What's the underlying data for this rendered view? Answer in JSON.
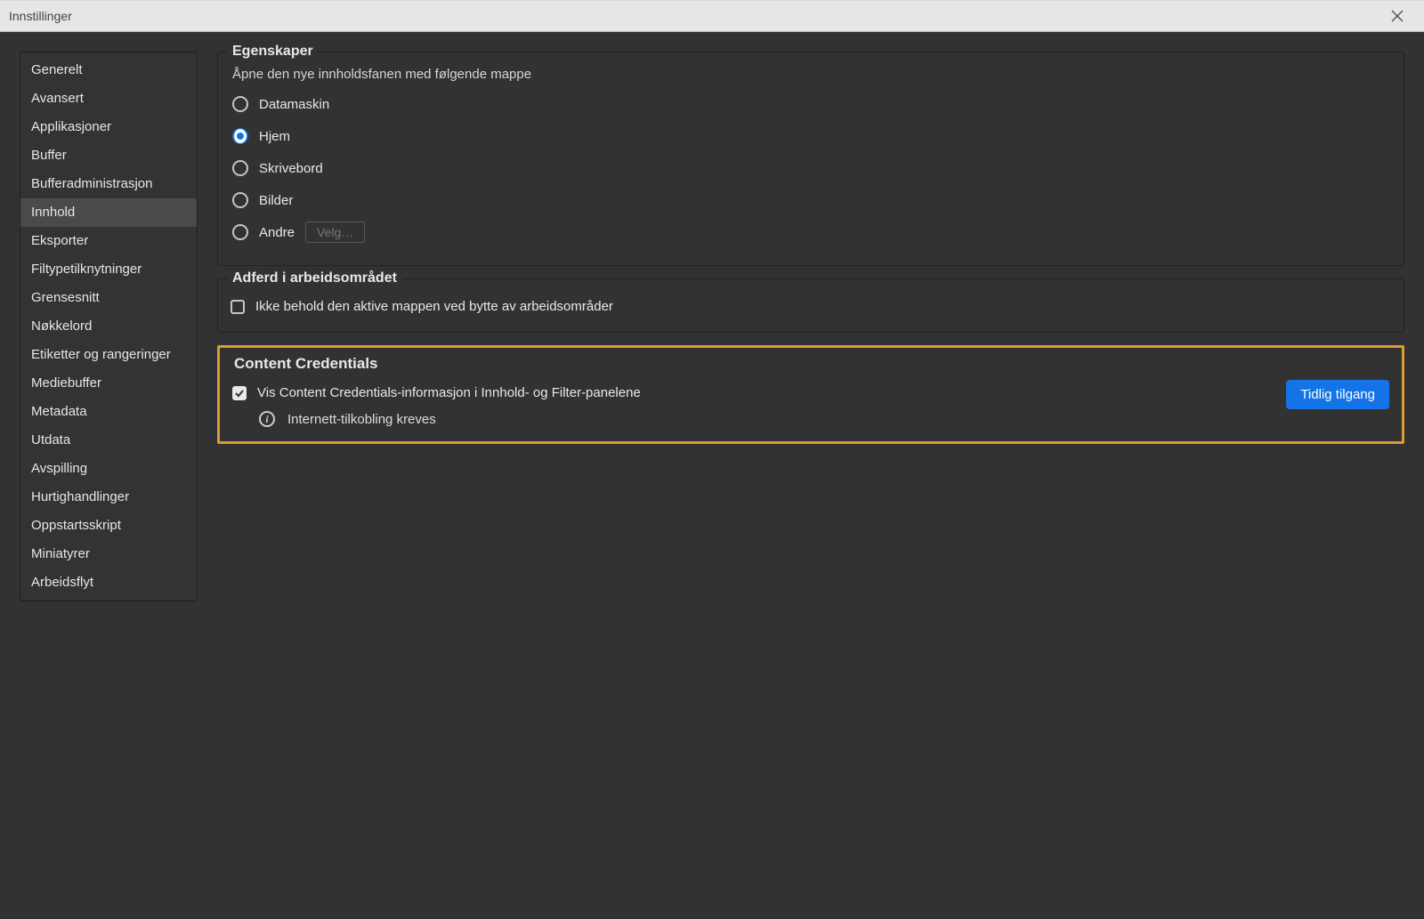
{
  "window": {
    "title": "Innstillinger"
  },
  "sidebar": {
    "items": [
      {
        "label": "Generelt",
        "selected": false
      },
      {
        "label": "Avansert",
        "selected": false
      },
      {
        "label": "Applikasjoner",
        "selected": false
      },
      {
        "label": "Buffer",
        "selected": false
      },
      {
        "label": "Bufferadministrasjon",
        "selected": false
      },
      {
        "label": "Innhold",
        "selected": true
      },
      {
        "label": "Eksporter",
        "selected": false
      },
      {
        "label": "Filtypetilknytninger",
        "selected": false
      },
      {
        "label": "Grensesnitt",
        "selected": false
      },
      {
        "label": "Nøkkelord",
        "selected": false
      },
      {
        "label": "Etiketter og rangeringer",
        "selected": false
      },
      {
        "label": "Mediebuffer",
        "selected": false
      },
      {
        "label": "Metadata",
        "selected": false
      },
      {
        "label": "Utdata",
        "selected": false
      },
      {
        "label": "Avspilling",
        "selected": false
      },
      {
        "label": "Hurtighandlinger",
        "selected": false
      },
      {
        "label": "Oppstartsskript",
        "selected": false
      },
      {
        "label": "Miniatyrer",
        "selected": false
      },
      {
        "label": "Arbeidsflyt",
        "selected": false
      }
    ]
  },
  "properties": {
    "legend": "Egenskaper",
    "description": "Åpne den nye innholdsfanen med følgende mappe",
    "options": [
      {
        "label": "Datamaskin",
        "selected": false
      },
      {
        "label": "Hjem",
        "selected": true
      },
      {
        "label": "Skrivebord",
        "selected": false
      },
      {
        "label": "Bilder",
        "selected": false
      },
      {
        "label": "Andre",
        "selected": false
      }
    ],
    "choose_button": "Velg…"
  },
  "workspace": {
    "legend": "Adferd i arbeidsområdet",
    "keep_active_folder": {
      "label": "Ikke behold den aktive mappen ved bytte av arbeidsområder",
      "checked": false
    }
  },
  "content_credentials": {
    "legend": "Content Credentials",
    "show_info": {
      "label": "Vis Content Credentials-informasjon i Innhold- og Filter-panelene",
      "checked": true
    },
    "info_note": "Internett-tilkobling kreves",
    "early_access_button": "Tidlig tilgang"
  }
}
